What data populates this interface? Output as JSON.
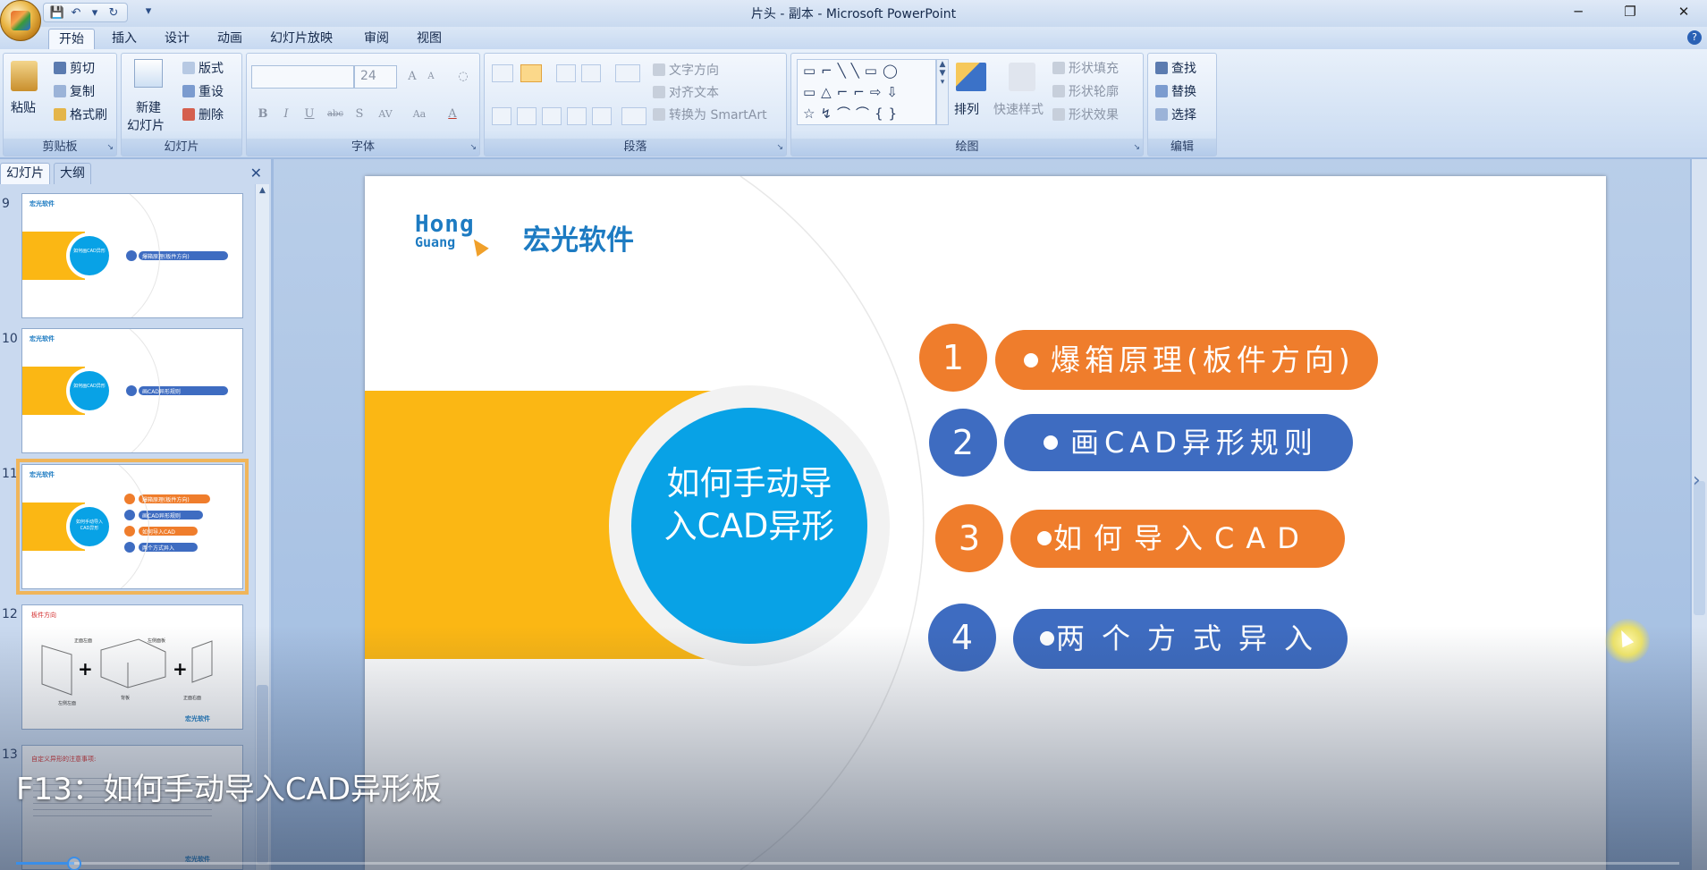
{
  "window": {
    "title": "片头 - 副本 - Microsoft PowerPoint",
    "minimize": "─",
    "restore": "❐",
    "close": "✕"
  },
  "qat": {
    "save": "💾",
    "undo": "↶",
    "undo_more": "▾",
    "redo": "↻",
    "customize": "▾"
  },
  "tabs": [
    "开始",
    "插入",
    "设计",
    "动画",
    "幻灯片放映",
    "审阅",
    "视图"
  ],
  "help_label": "?",
  "ribbon": {
    "clipboard": {
      "label": "剪贴板",
      "paste": "粘贴",
      "cut": "剪切",
      "copy": "复制",
      "format_painter": "格式刷"
    },
    "slides": {
      "label": "幻灯片",
      "new_slide_line1": "新建",
      "new_slide_line2": "幻灯片",
      "layout": "版式",
      "reset": "重设",
      "delete": "删除"
    },
    "font": {
      "label": "字体",
      "font_name": "",
      "font_size": "24",
      "grow": "A",
      "shrink": "A",
      "bold": "B",
      "italic": "I",
      "underline": "U",
      "strike": "abc",
      "shadow": "S",
      "spacing": "AV",
      "case": "Aa",
      "color": "A"
    },
    "paragraph": {
      "label": "段落",
      "text_direction": "文字方向",
      "align_text": "对齐文本",
      "smartart": "转换为 SmartArt"
    },
    "drawing": {
      "label": "绘图",
      "arrange": "排列",
      "quick_styles": "快速样式",
      "fill": "形状填充",
      "outline": "形状轮廓",
      "effects": "形状效果"
    },
    "editing": {
      "label": "编辑",
      "find": "查找",
      "replace": "替换",
      "select": "选择"
    }
  },
  "panel": {
    "tab_slides": "幻灯片",
    "tab_outline": "大纲",
    "close": "✕",
    "thumbnails": [
      {
        "num": "9",
        "title": "如何画CAD异形",
        "item": "爆箱原理(板件方向)"
      },
      {
        "num": "10",
        "title": "如何画CAD异形",
        "item": "画CAD异形规则"
      },
      {
        "num": "11",
        "title": "如何手动导入CAD异形",
        "items": [
          "爆箱原理(板件方向)",
          "画CAD异形规则",
          "如何导入CAD",
          "两个方式异入"
        ]
      },
      {
        "num": "12",
        "title": "板件方向",
        "labels": [
          "正面左面",
          "左侧面板",
          "背板",
          "左侧左面",
          "正面右面"
        ]
      },
      {
        "num": "13",
        "title": "自定义异形的注意事项:"
      }
    ]
  },
  "slide": {
    "logo_en_top": "Hong",
    "logo_en_bottom": "Guang",
    "logo_cn": "宏光软件",
    "circle_line1": "如何手动导",
    "circle_line2": "入CAD异形",
    "items": [
      {
        "num": "1",
        "text": "爆箱原理(板件方向)",
        "color": "#ef7d2c"
      },
      {
        "num": "2",
        "text": "画CAD异形规则",
        "color": "#3e6cc1"
      },
      {
        "num": "3",
        "text": "如何导入CAD",
        "color": "#ef7d2c"
      },
      {
        "num": "4",
        "text": "两个方式异入",
        "color": "#3e6cc1"
      }
    ],
    "colors": {
      "band": "#fbb714",
      "circle": "#08a2e6",
      "orange": "#ef7d2c",
      "blue": "#3e6cc1"
    }
  },
  "caption": "F13：如何手动导入CAD异形板",
  "video_progress_fraction": 0.035
}
